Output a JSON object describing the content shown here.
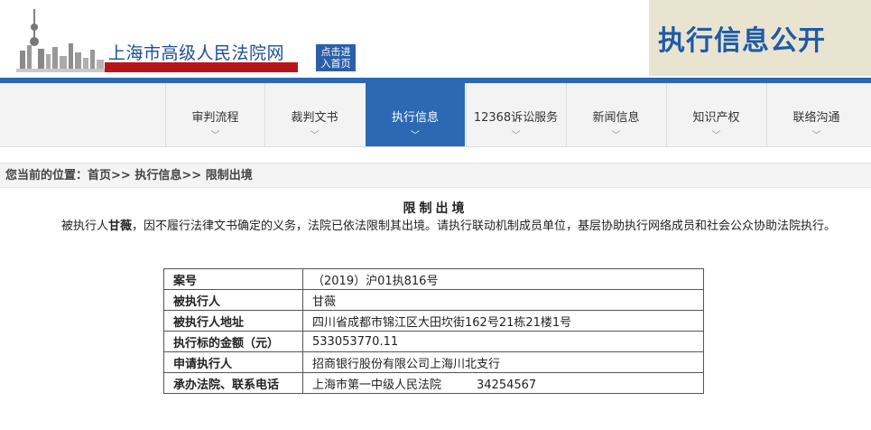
{
  "header": {
    "site_title": "上海市高级人民法院网",
    "home_button_line1": "点击进",
    "home_button_line2": "入首页",
    "banner_text": "执行信息公开"
  },
  "nav": {
    "items": [
      {
        "label": "审判流程",
        "active": false
      },
      {
        "label": "裁判文书",
        "active": false
      },
      {
        "label": "执行信息",
        "active": true
      },
      {
        "label": "12368诉讼服务",
        "active": false
      },
      {
        "label": "新闻信息",
        "active": false
      },
      {
        "label": "知识产权",
        "active": false
      },
      {
        "label": "联络沟通",
        "active": false
      }
    ],
    "active_color": "#2d68b2"
  },
  "breadcrumb": {
    "prefix": "您当前的位置：",
    "home": "首页",
    "section": "执行信息",
    "current": "限制出境",
    "separator": ">>"
  },
  "document": {
    "title": "限制出境",
    "para_before": "被执行人",
    "para_name": "甘薇",
    "para_after": "，因不履行法律文书确定的义务，法院已依法限制其出境。请执行联动机制成员单位，基层协助执行网络成员和社会公众协助法院执行。"
  },
  "table": {
    "rows": [
      {
        "key": "案号",
        "value": "（2019）沪01执816号"
      },
      {
        "key": "被执行人",
        "value": "甘薇"
      },
      {
        "key": "被执行人地址",
        "value": "四川省成都市锦江区大田坎街162号21栋21楼1号"
      },
      {
        "key": "执行标的金额（元）",
        "value": "533053770.11"
      },
      {
        "key": "申请执行人",
        "value": "招商银行股份有限公司上海川北支行"
      },
      {
        "key": "承办法院、联系电话",
        "value": "上海市第一中级人民法院　　　34254567"
      }
    ]
  }
}
